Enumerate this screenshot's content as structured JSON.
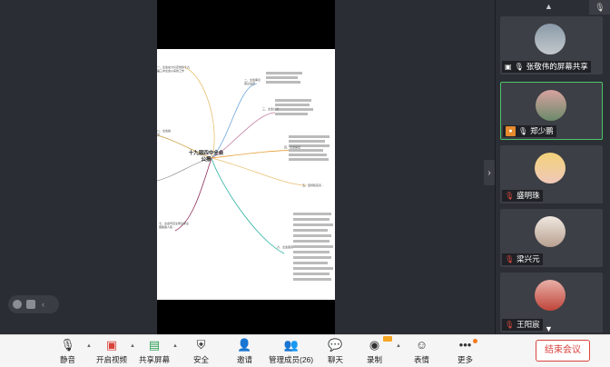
{
  "shared_doc": {
    "center_title": "十九届四中全会公报",
    "node_labels": [
      "一、全会充分肯定党的十九届三中全会以来的工作",
      "二、全会审议通过决定",
      "三、全会认为",
      "四、全会提出",
      "五、坚持和完善…",
      "六、全会强调",
      "七、全会号召全党全军全国各族人民…",
      "八、全会指出…"
    ]
  },
  "participants": [
    {
      "name": "张敬伟的屏幕共享",
      "status": "screen-share"
    },
    {
      "name": "郑少鹏",
      "status": "host"
    },
    {
      "name": "盛明珠",
      "status": "muted"
    },
    {
      "name": "梁兴元",
      "status": "muted"
    },
    {
      "name": "王阳宸",
      "status": "muted"
    }
  ],
  "toolbar": {
    "mute": "静音",
    "video": "开启视频",
    "share": "共享屏幕",
    "security": "安全",
    "invite": "邀请",
    "members": "管理成员(26)",
    "chat": "聊天",
    "record": "录制",
    "reactions": "表情",
    "more": "更多",
    "end": "结束会议"
  },
  "colors": {
    "accent_green": "#4cc36a",
    "end_red": "#d9433c",
    "badge_orange": "#f57c20"
  }
}
